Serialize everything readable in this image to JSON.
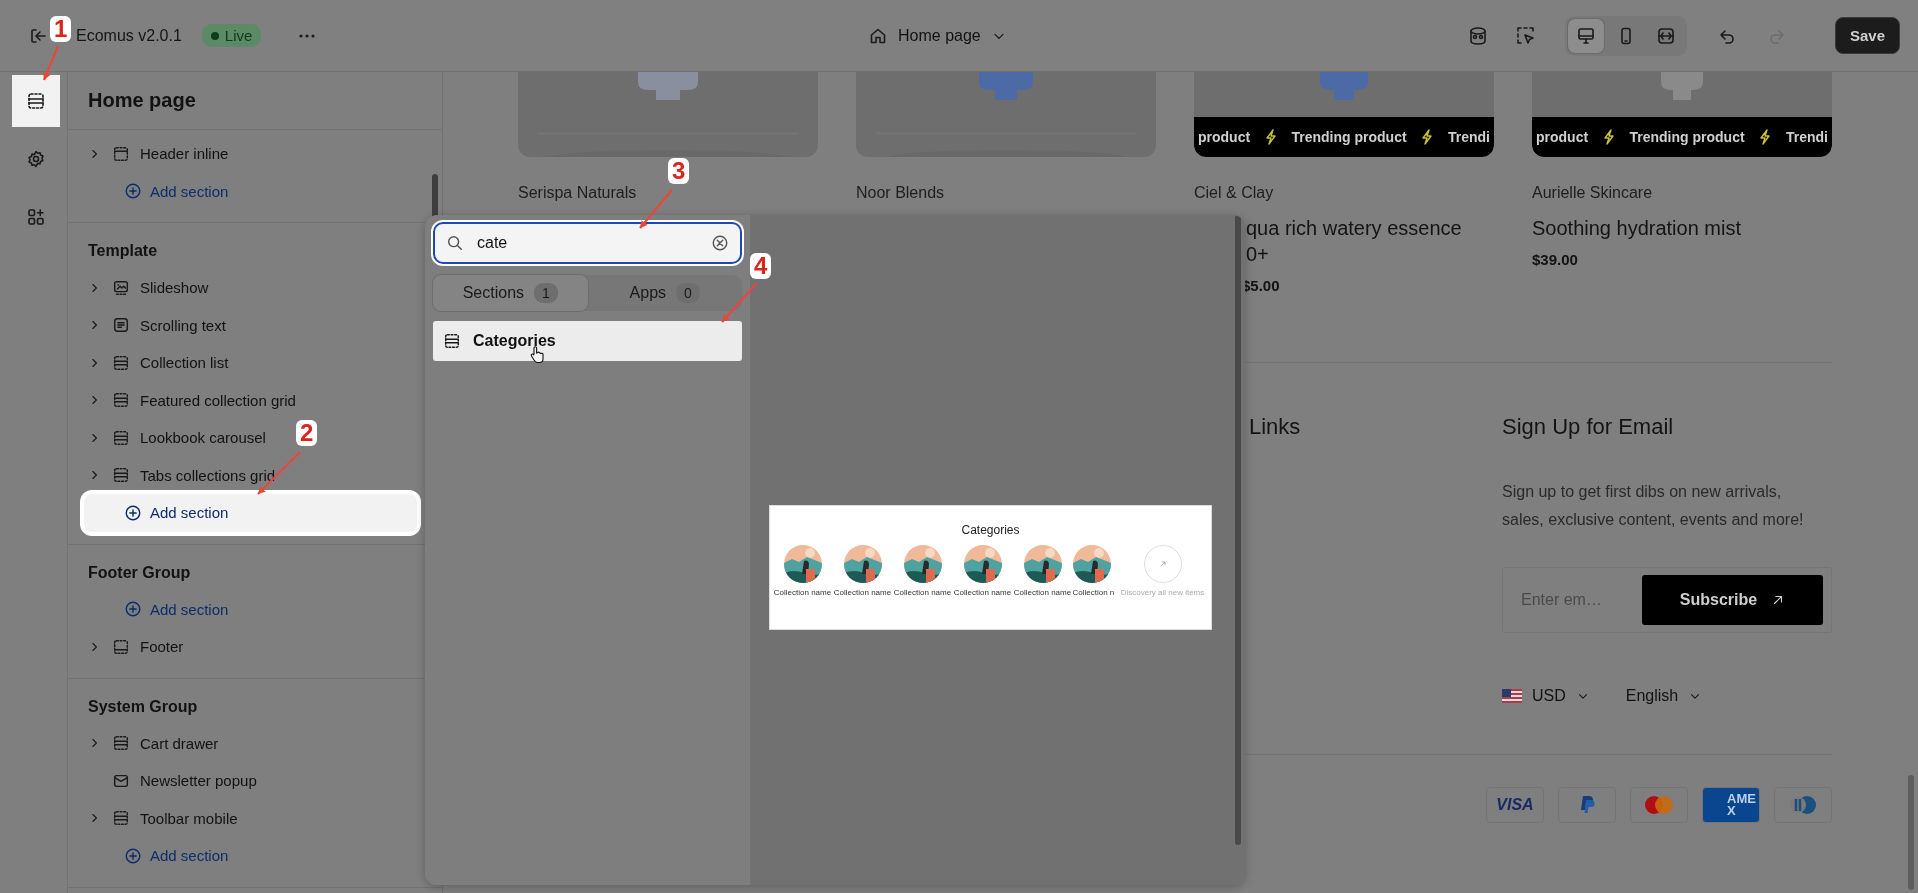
{
  "topbar": {
    "title": "Ecomus v2.0.1",
    "status": "Live",
    "page": "Home page",
    "view_modes": [
      {
        "kind": "desktop",
        "selected": true
      },
      {
        "kind": "mobile",
        "selected": false
      },
      {
        "kind": "fullwidth",
        "selected": false
      }
    ],
    "history": [
      {
        "kind": "undo",
        "disabled": false
      },
      {
        "kind": "redo",
        "disabled": true
      }
    ],
    "save": "Save"
  },
  "rail": [
    {
      "kind": "sections",
      "selected": true
    },
    {
      "kind": "settings",
      "selected": false
    },
    {
      "kind": "apps",
      "selected": false
    }
  ],
  "sidebar": {
    "title": "Home page",
    "groups": [
      {
        "items": [
          {
            "kind": "header",
            "label": "Header inline",
            "expandable": true
          },
          {
            "kind": "add",
            "label": "Add section",
            "highlighted": false
          }
        ]
      },
      {
        "title": "Template",
        "items": [
          {
            "kind": "slideshow",
            "label": "Slideshow",
            "expandable": true
          },
          {
            "kind": "text",
            "label": "Scrolling text",
            "expandable": true
          },
          {
            "kind": "section",
            "label": "Collection list",
            "expandable": true
          },
          {
            "kind": "section",
            "label": "Featured collection grid",
            "expandable": true
          },
          {
            "kind": "section",
            "label": "Lookbook carousel",
            "expandable": true
          },
          {
            "kind": "section",
            "label": "Tabs collections grid",
            "expandable": true
          },
          {
            "kind": "add",
            "label": "Add section",
            "highlighted": true
          }
        ]
      },
      {
        "title": "Footer Group",
        "items": [
          {
            "kind": "add",
            "label": "Add section",
            "highlighted": false
          },
          {
            "kind": "footer",
            "label": "Footer",
            "expandable": true
          }
        ]
      },
      {
        "title": "System Group",
        "items": [
          {
            "kind": "section",
            "label": "Cart drawer",
            "expandable": true
          },
          {
            "kind": "mail",
            "label": "Newsletter popup",
            "expandable": false
          },
          {
            "kind": "section",
            "label": "Toolbar mobile",
            "expandable": true
          },
          {
            "kind": "add",
            "label": "Add section",
            "highlighted": false
          }
        ]
      }
    ]
  },
  "preview": {
    "products": [
      {
        "vendor": "Serispa Naturals"
      },
      {
        "vendor": "Noor Blends"
      },
      {
        "vendor": "Ciel & Clay",
        "title_lines": [
          "qua rich watery essence",
          "0+"
        ],
        "price": "$5.00",
        "marquee": [
          "product",
          "Trending product",
          "Trendi"
        ]
      },
      {
        "vendor": "Aurielle Skincare",
        "title_lines": [
          "Soothing hydration mist"
        ],
        "price": "$39.00",
        "marquee": [
          "product",
          "Trending product",
          "Trendi"
        ]
      }
    ],
    "footer": {
      "links_heading": "Links",
      "signup_heading": "Sign Up for Email",
      "signup_text": "Sign up to get first dibs on new arrivals, sales, exclusive content, events and more!",
      "email_placeholder": "Enter em…",
      "subscribe": "Subscribe",
      "currency": "USD",
      "language": "English",
      "payments": [
        {
          "kind": "visa",
          "label": "VISA"
        },
        {
          "kind": "paypal"
        },
        {
          "kind": "mastercard"
        },
        {
          "kind": "amex",
          "label": "AMEX"
        },
        {
          "kind": "diners"
        }
      ]
    }
  },
  "popup": {
    "search": {
      "value": "cate"
    },
    "tabs": [
      {
        "label": "Sections",
        "count": "1",
        "selected": true
      },
      {
        "label": "Apps",
        "count": "0",
        "selected": false
      }
    ],
    "results": [
      {
        "label": "Categories",
        "highlighted": true
      }
    ],
    "preview_card": {
      "title": "Categories",
      "items": [
        "Collection name",
        "Collection name",
        "Collection name",
        "Collection name",
        "Collection name",
        "Collection n"
      ],
      "more": "Discovery all new items"
    }
  },
  "annotations": [
    {
      "label": "1"
    },
    {
      "label": "2"
    },
    {
      "label": "3"
    },
    {
      "label": "4"
    }
  ]
}
